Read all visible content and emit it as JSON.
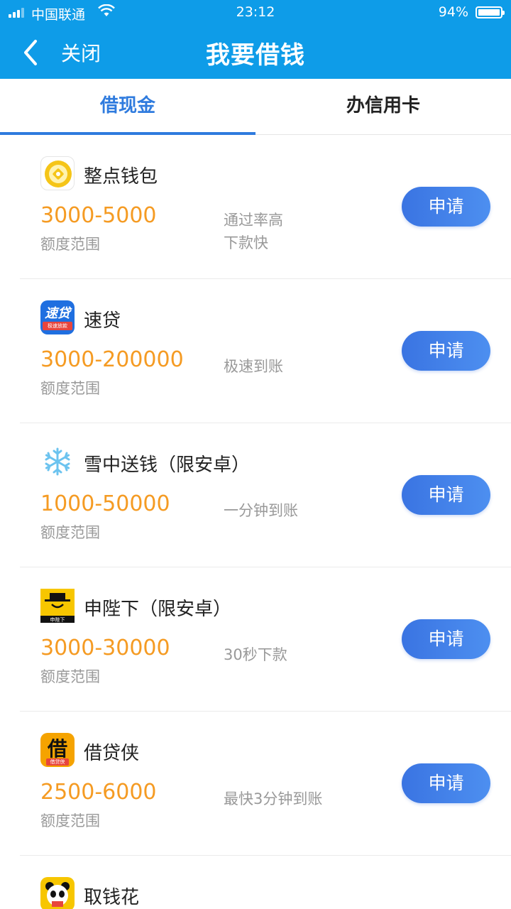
{
  "status_bar": {
    "carrier": "中国联通",
    "time": "23:12",
    "battery": "94%"
  },
  "nav": {
    "close_label": "关闭",
    "title": "我要借钱"
  },
  "tabs": [
    {
      "label": "借现金",
      "active": true
    },
    {
      "label": "办信用卡",
      "active": false
    }
  ],
  "colors": {
    "header": "#0e9ce8",
    "accent": "#2f7bde",
    "amount": "#f59b23",
    "button": "#3a74e2"
  },
  "items": [
    {
      "name": "整点钱包",
      "icon": "coin-wallet-icon",
      "amount": "3000-5000",
      "amount_label": "额度范围",
      "desc": [
        "通过率高",
        "下款快"
      ],
      "button": "申请"
    },
    {
      "name": "速贷",
      "icon": "sudai-logo-icon",
      "amount": "3000-200000",
      "amount_label": "额度范围",
      "desc": [
        "极速到账"
      ],
      "button": "申请"
    },
    {
      "name": "雪中送钱（限安卓）",
      "icon": "snowflake-icon",
      "amount": "1000-50000",
      "amount_label": "额度范围",
      "desc": [
        "一分钟到账"
      ],
      "button": "申请"
    },
    {
      "name": "申陛下（限安卓）",
      "icon": "emperor-logo-icon",
      "amount": "3000-30000",
      "amount_label": "额度范围",
      "desc": [
        "30秒下款"
      ],
      "button": "申请"
    },
    {
      "name": "借贷侠",
      "icon": "jiedaixia-logo-icon",
      "amount": "2500-6000",
      "amount_label": "额度范围",
      "desc": [
        "最快3分钟到账"
      ],
      "button": "申请"
    },
    {
      "name": "取钱花",
      "icon": "panda-logo-icon"
    }
  ],
  "logos": {
    "sudai_text": "速贷",
    "sudai_sub": "极速放款",
    "emperor_sub": "申陛下",
    "jiedaixia_char": "借",
    "jiedaixia_sub": "借贷侠"
  }
}
